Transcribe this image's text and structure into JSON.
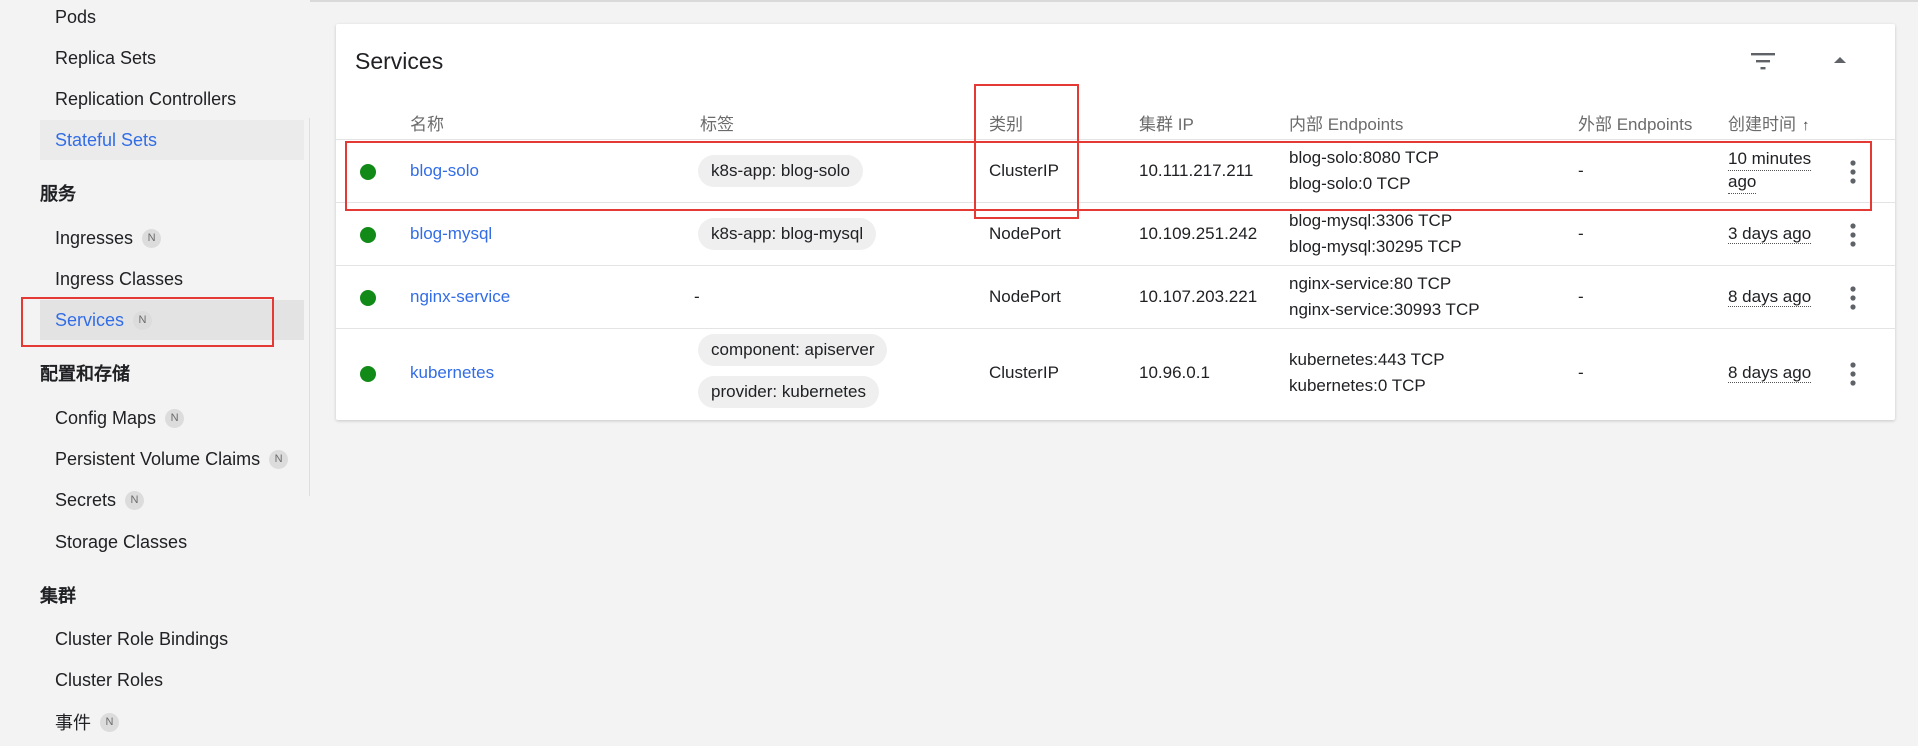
{
  "sidebar": {
    "items_top": [
      {
        "label": "Pods"
      },
      {
        "label": "Replica Sets"
      },
      {
        "label": "Replication Controllers"
      },
      {
        "label": "Stateful Sets"
      }
    ],
    "section_service": "服务",
    "items_service": [
      {
        "label": "Ingresses",
        "badge": "N"
      },
      {
        "label": "Ingress Classes"
      },
      {
        "label": "Services",
        "badge": "N"
      }
    ],
    "section_config": "配置和存储",
    "items_config": [
      {
        "label": "Config Maps",
        "badge": "N"
      },
      {
        "label": "Persistent Volume Claims",
        "badge": "N"
      },
      {
        "label": "Secrets",
        "badge": "N"
      },
      {
        "label": "Storage Classes"
      }
    ],
    "section_cluster": "集群",
    "items_cluster": [
      {
        "label": "Cluster Role Bindings"
      },
      {
        "label": "Cluster Roles"
      },
      {
        "label": "事件",
        "badge": "N"
      }
    ]
  },
  "services_card": {
    "title": "Services",
    "columns": {
      "name": "名称",
      "labels": "标签",
      "type": "类别",
      "cluster_ip": "集群 IP",
      "internal_endpoints": "内部 Endpoints",
      "external_endpoints": "外部 Endpoints",
      "created": "创建时间",
      "sort_arrow": "↑"
    },
    "rows": [
      {
        "name": "blog-solo",
        "labels": [
          "k8s-app: blog-solo"
        ],
        "type": "ClusterIP",
        "cluster_ip": "10.111.217.211",
        "internal_endpoints": [
          "blog-solo:8080 TCP",
          "blog-solo:0 TCP"
        ],
        "external_endpoints": "-",
        "created_line1": "10 minutes",
        "created_line2": "ago"
      },
      {
        "name": "blog-mysql",
        "labels": [
          "k8s-app: blog-mysql"
        ],
        "type": "NodePort",
        "cluster_ip": "10.109.251.242",
        "internal_endpoints": [
          "blog-mysql:3306 TCP",
          "blog-mysql:30295 TCP"
        ],
        "external_endpoints": "-",
        "created": "3 days ago"
      },
      {
        "name": "nginx-service",
        "labels_empty": "-",
        "type": "NodePort",
        "cluster_ip": "10.107.203.221",
        "internal_endpoints": [
          "nginx-service:80 TCP",
          "nginx-service:30993 TCP"
        ],
        "external_endpoints": "-",
        "created": "8 days ago"
      },
      {
        "name": "kubernetes",
        "labels": [
          "component: apiserver",
          "provider: kubernetes"
        ],
        "type": "ClusterIP",
        "cluster_ip": "10.96.0.1",
        "internal_endpoints": [
          "kubernetes:443 TCP",
          "kubernetes:0 TCP"
        ],
        "external_endpoints": "-",
        "created": "8 days ago"
      }
    ]
  },
  "colors": {
    "link": "#326de6",
    "status_running": "#128a18",
    "highlight": "#e53935"
  }
}
